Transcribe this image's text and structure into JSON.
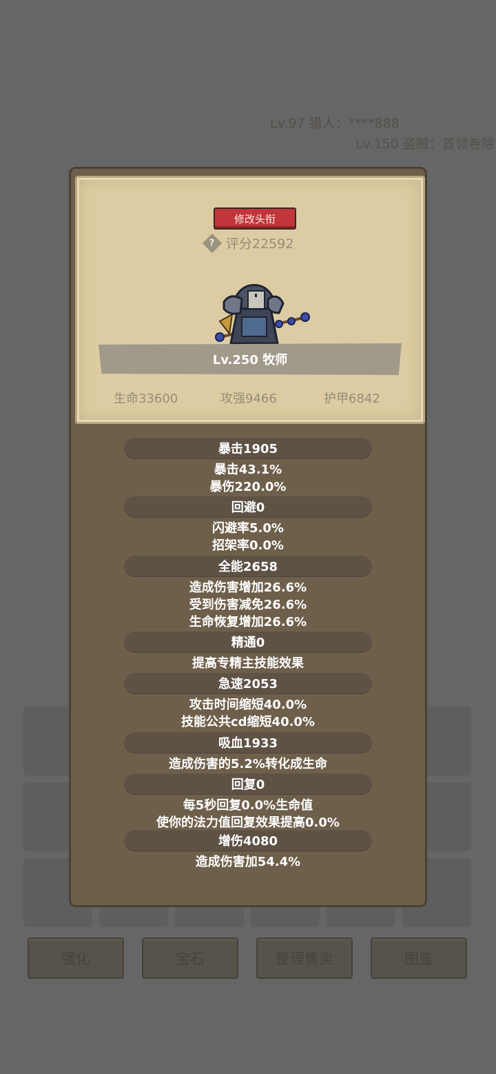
{
  "ticker": [
    "Lv.97 猎人：****888",
    "Lv.150 盗贼：首领卷除"
  ],
  "modal": {
    "title_button": "修改头衔",
    "help_icon": "?",
    "score": "评分22592",
    "level_class": "Lv.250 牧师",
    "stats": {
      "hp": "生命33600",
      "attack": "攻强9466",
      "armor": "护甲6842"
    },
    "attributes": [
      {
        "header": "暴击1905",
        "lines": [
          "暴击43.1%",
          "暴伤220.0%"
        ]
      },
      {
        "header": "回避0",
        "lines": [
          "闪避率5.0%",
          "招架率0.0%"
        ]
      },
      {
        "header": "全能2658",
        "lines": [
          "造成伤害增加26.6%",
          "受到伤害减免26.6%",
          "生命恢复增加26.6%"
        ]
      },
      {
        "header": "精通0",
        "lines": [
          "提高专精主技能效果"
        ]
      },
      {
        "header": "急速2053",
        "lines": [
          "攻击时间缩短40.0%",
          "技能公共cd缩短40.0%"
        ]
      },
      {
        "header": "吸血1933",
        "lines": [
          "造成伤害的5.2%转化成生命"
        ]
      },
      {
        "header": "回复0",
        "lines": [
          "每5秒回复0.0%生命值",
          "使你的法力值回复效果提高0.0%"
        ]
      },
      {
        "header": "增伤4080",
        "lines": [
          "造成伤害加54.4%"
        ]
      }
    ]
  },
  "bottom_buttons": [
    "强化",
    "宝石",
    "整理售卖",
    "图鉴"
  ],
  "colors": {
    "backdrop": "#666666",
    "modal_bg": "#6e5f4b",
    "parchment": "#ddcca3",
    "title_button": "#c0363a"
  }
}
